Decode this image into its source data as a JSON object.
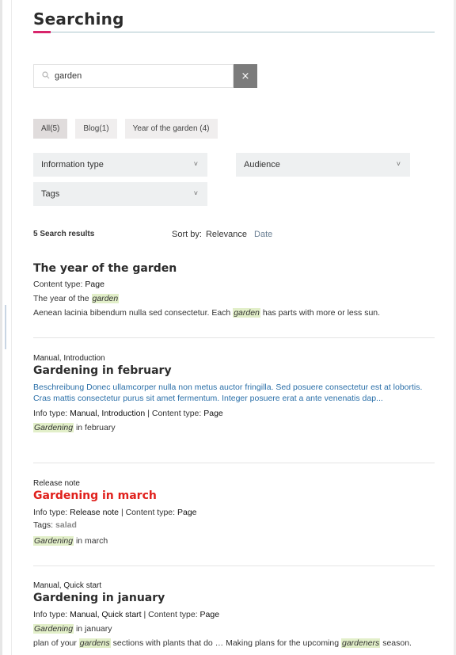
{
  "page": {
    "title": "Searching"
  },
  "search": {
    "value": "garden",
    "clear_icon": "×"
  },
  "facets": [
    {
      "label": "All(5)",
      "active": true
    },
    {
      "label": "Blog(1)"
    },
    {
      "label": "Year of the garden (4)"
    }
  ],
  "filters": {
    "info_type": "Information type",
    "audience": "Audience",
    "tags": "Tags",
    "chevron": "˅"
  },
  "results_summary": {
    "count": "5 Search results",
    "sort_label": "Sort by:",
    "sort_relevance": "Relevance",
    "sort_date": "Date"
  },
  "results": [
    {
      "title": "The year of the garden",
      "content_type_label": "Content type:",
      "content_type": "Page",
      "line1_pre": "The year of the",
      "line1_hl": "garden",
      "line2_pre": "Aenean lacinia bibendum nulla sed consectetur. Each",
      "line2_hl": "garden",
      "line2_post": "has parts with more or less sun."
    },
    {
      "meta": "Manual,  Introduction",
      "title": "Gardening in february",
      "desc": "Beschreibung Donec ullamcorper nulla non metus auctor fringilla. Sed posuere consectetur est at lobortis. Cras mattis consectetur purus sit amet fermentum. Integer posuere erat a ante venenatis dap...",
      "info_label": "Info type:",
      "info": "Manual,  Introduction",
      "content_type_label": "Content type:",
      "content_type": "Page",
      "snippet_hl": "Gardening",
      "snippet_post": "in february"
    },
    {
      "meta": "Release note",
      "title": "Gardening in march",
      "info_label": "Info type:",
      "info": "Release note",
      "content_type_label": "Content type:",
      "content_type": "Page",
      "tags_label": "Tags:",
      "tags": "salad",
      "snippet_hl": "Gardening",
      "snippet_post": "in march"
    },
    {
      "meta": "Manual,  Quick start",
      "title": "Gardening in january",
      "info_label": "Info type:",
      "info": "Manual,  Quick start",
      "content_type_label": "Content type:",
      "content_type": "Page",
      "snippet_hl": "Gardening",
      "snippet_post": "in january",
      "line_pre": "plan of your",
      "line_hl1": "gardens",
      "line_mid": "sections with plants that do … Making plans for the upcoming",
      "line_hl2": "gardeners",
      "line_post": "season."
    }
  ],
  "colors": {
    "accent": "#d8256b",
    "title_red": "#e0201c",
    "link_blue": "#2a6fa8",
    "highlight": "#e2efc9"
  }
}
